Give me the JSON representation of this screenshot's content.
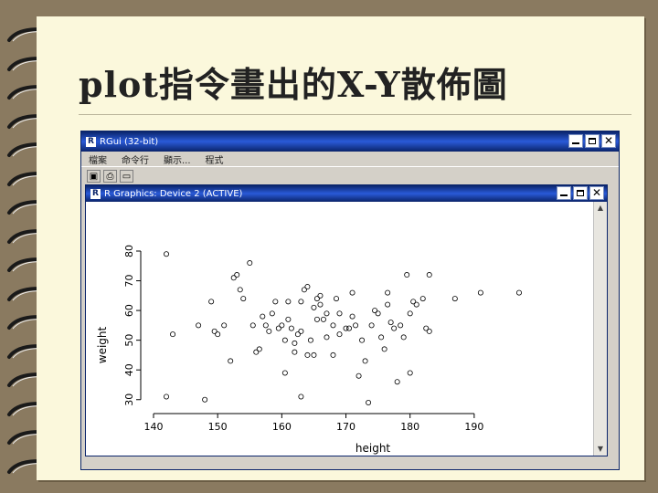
{
  "slide": {
    "title": "plot指令畫出的X-Y散佈圖"
  },
  "rgui_window": {
    "title": "RGui (32-bit)",
    "menu": [
      "檔案",
      "命令行",
      "顯示...",
      "程式"
    ],
    "toolbar": [
      "open-icon",
      "save-icon",
      "copy-icon"
    ]
  },
  "graphics_window": {
    "title": "R Graphics: Device 2 (ACTIVE)"
  },
  "chart_data": {
    "type": "scatter",
    "title": "",
    "xlabel": "height",
    "ylabel": "weight",
    "xlim": [
      140,
      197
    ],
    "ylim": [
      29,
      80
    ],
    "xticks": [
      140,
      150,
      160,
      170,
      180,
      190
    ],
    "yticks": [
      30,
      40,
      50,
      60,
      70,
      80
    ],
    "grid": false,
    "points": [
      [
        142,
        79
      ],
      [
        142,
        31
      ],
      [
        143,
        52
      ],
      [
        147,
        55
      ],
      [
        148,
        30
      ],
      [
        149,
        63
      ],
      [
        149.5,
        53
      ],
      [
        150,
        52
      ],
      [
        151,
        55
      ],
      [
        152,
        43
      ],
      [
        152.5,
        71
      ],
      [
        153,
        72
      ],
      [
        153.5,
        67
      ],
      [
        154,
        64
      ],
      [
        155,
        76
      ],
      [
        155.5,
        55
      ],
      [
        156,
        46
      ],
      [
        156.5,
        47
      ],
      [
        157,
        58
      ],
      [
        157.5,
        55
      ],
      [
        158,
        53
      ],
      [
        158.5,
        59
      ],
      [
        159,
        63
      ],
      [
        159.5,
        54
      ],
      [
        160,
        55
      ],
      [
        160.5,
        50
      ],
      [
        160.5,
        39
      ],
      [
        161,
        63
      ],
      [
        161,
        57
      ],
      [
        161.5,
        54
      ],
      [
        162,
        49
      ],
      [
        162.5,
        52
      ],
      [
        162,
        46
      ],
      [
        163,
        53
      ],
      [
        163,
        63
      ],
      [
        163,
        31
      ],
      [
        163.5,
        67
      ],
      [
        164,
        45
      ],
      [
        164,
        68
      ],
      [
        164.5,
        50
      ],
      [
        165,
        45
      ],
      [
        165,
        61
      ],
      [
        165.5,
        57
      ],
      [
        165.5,
        64
      ],
      [
        166,
        62
      ],
      [
        166,
        65
      ],
      [
        166.5,
        57
      ],
      [
        167,
        51
      ],
      [
        167,
        59
      ],
      [
        168,
        45
      ],
      [
        168,
        55
      ],
      [
        168.5,
        64
      ],
      [
        169,
        59
      ],
      [
        169,
        52
      ],
      [
        170,
        54
      ],
      [
        170.5,
        54
      ],
      [
        171,
        58
      ],
      [
        171,
        66
      ],
      [
        171.5,
        55
      ],
      [
        172,
        38
      ],
      [
        172.5,
        50
      ],
      [
        173,
        43
      ],
      [
        173.5,
        29
      ],
      [
        174,
        55
      ],
      [
        174.5,
        60
      ],
      [
        175,
        59
      ],
      [
        175.5,
        51
      ],
      [
        176,
        47
      ],
      [
        176.5,
        62
      ],
      [
        176.5,
        66
      ],
      [
        177,
        56
      ],
      [
        177.5,
        54
      ],
      [
        178,
        36
      ],
      [
        178.5,
        55
      ],
      [
        179,
        51
      ],
      [
        179.5,
        72
      ],
      [
        180,
        59
      ],
      [
        180,
        39
      ],
      [
        180.5,
        63
      ],
      [
        181,
        62
      ],
      [
        182,
        64
      ],
      [
        182.5,
        54
      ],
      [
        183,
        72
      ],
      [
        183,
        53
      ],
      [
        187,
        64
      ],
      [
        191,
        66
      ],
      [
        197,
        66
      ]
    ]
  }
}
